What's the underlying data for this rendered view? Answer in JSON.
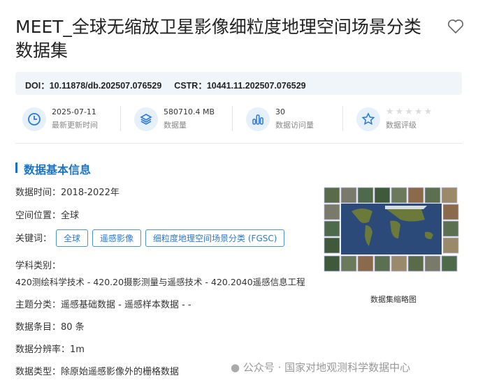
{
  "title": "MEET_全球无缩放卫星影像细粒度地理空间场景分类数据集",
  "doi": "DOI：10.11878/db.202507.076529",
  "cstr": "CSTR：10441.11.202507.076529",
  "stats": [
    {
      "value": "2025-07-11",
      "label": "最新更新时间",
      "icon": "clock-icon"
    },
    {
      "value": "580710.4 MB",
      "label": "数据量",
      "icon": "layers-icon"
    },
    {
      "value": "30",
      "label": "数据访问量",
      "icon": "bar-chart-icon"
    },
    {
      "value": "",
      "label": "数据评级",
      "icon": "star-icon",
      "rating": 0,
      "max": 5
    }
  ],
  "section_title": "数据基本信息",
  "info": {
    "time": "数据时间：2018-2022年",
    "location": "空间位置：全球",
    "keywords_label": "关键词：",
    "keywords": [
      "全球",
      "遥感影像",
      "细粒度地理空间场景分类 (FGSC)"
    ],
    "subject_label": "学科类别：",
    "subject": "420测绘科学技术 - 420.20摄影测量与遥感技术 - 420.2040遥感信息工程",
    "theme": "主题分类：遥感基础数据 - 遥感样本数据 - -",
    "entries": "数据条目：80 条",
    "resolution": "数据分辨率：1m",
    "type": "数据类型：除原始遥感影像外的栅格数据"
  },
  "thumbnail_caption": "数据集缩略图",
  "watermark": "公众号 · 国家对地观测科学数据中心"
}
